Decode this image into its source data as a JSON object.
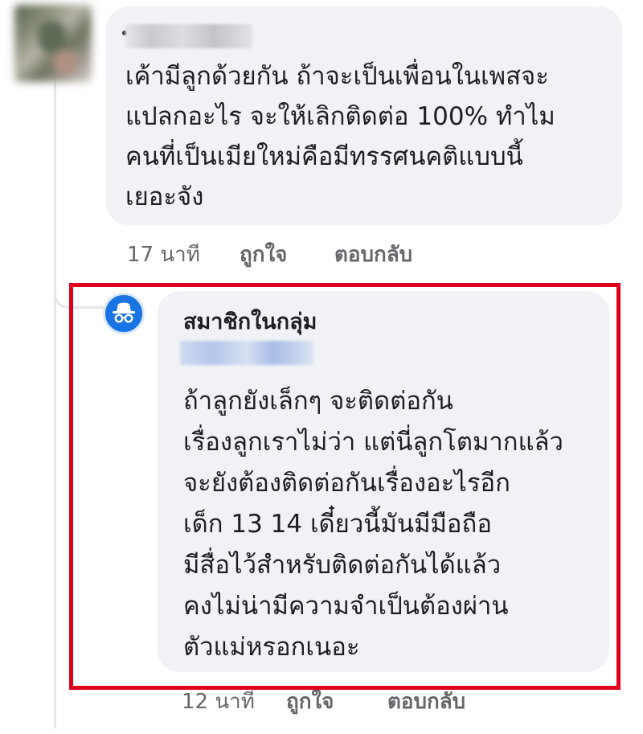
{
  "comments": [
    {
      "author_name": "",
      "text_lines": [
        "เค้ามีลูกด้วยกัน ถ้าจะเป็นเพื่อนในเพสจะ",
        "แปลกอะไร จะให้เลิกติดต่อ 100% ทำไม",
        "คนที่เป็นเมียใหม่คือมีทรรศนคติแบบนี้",
        "เยอะจัง"
      ],
      "time": "17 นาที",
      "like_label": "ถูกใจ",
      "reply_label": "ตอบกลับ"
    },
    {
      "author_name": "สมาชิกในกลุ่ม",
      "text_lines": [
        "ถ้าลูกยังเล็กๆ จะติดต่อกัน",
        "เรื่องลูกเราไม่ว่า แต่นี่ลูกโตมากแล้ว",
        "จะยังต้องติดต่อกันเรื่องอะไรอีก",
        "เด็ก 13 14 เดี๋ยวนี้มันมีมือถือ",
        "มีสื่อไว้สำหรับติดต่อกันได้แล้ว",
        "คงไม่น่ามีความจำเป็นต้องผ่าน",
        "ตัวแม่หรอกเนอะ"
      ],
      "time": "12 นาที",
      "like_label": "ถูกใจ",
      "reply_label": "ตอบกลับ"
    }
  ],
  "colors": {
    "bubble_bg": "#f0f2f5",
    "secondary_text": "#65676b",
    "highlight_border": "#e0001b",
    "anon_avatar_bg": "#1b74e4"
  },
  "icons": {
    "anonymous_avatar": "incognito-icon"
  }
}
